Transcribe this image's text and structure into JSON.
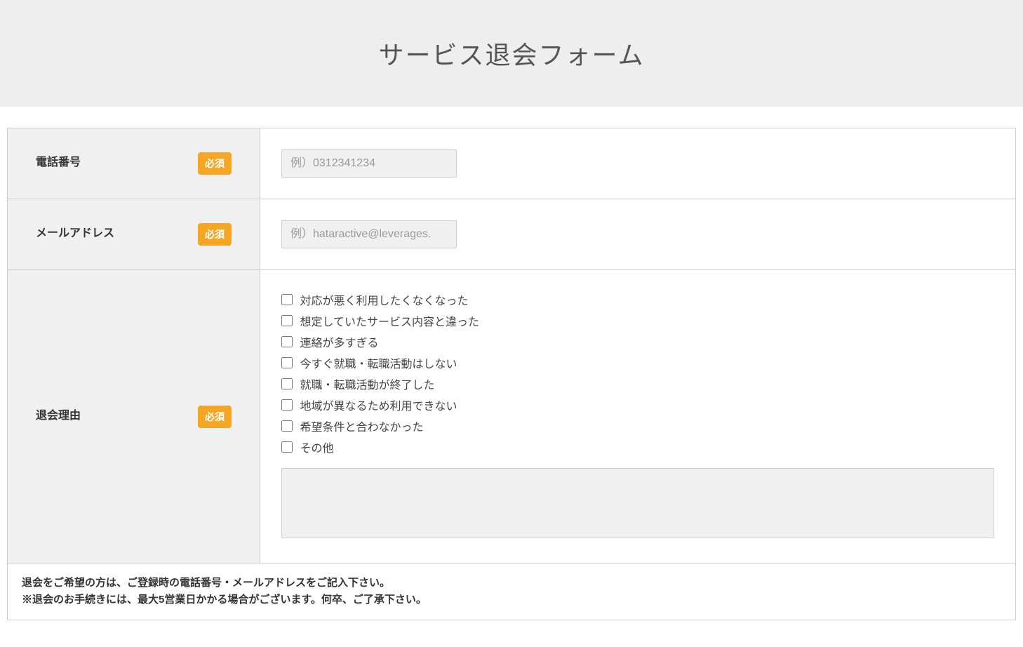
{
  "header": {
    "title": "サービス退会フォーム"
  },
  "labels": {
    "required": "必須"
  },
  "fields": {
    "phone": {
      "label": "電話番号",
      "placeholder": "例）0312341234"
    },
    "email": {
      "label": "メールアドレス",
      "placeholder": "例）hataractive@leverages."
    },
    "reason": {
      "label": "退会理由",
      "options": [
        "対応が悪く利用したくなくなった",
        "想定していたサービス内容と違った",
        "連絡が多すぎる",
        "今すぐ就職・転職活動はしない",
        "就職・転職活動が終了した",
        "地域が異なるため利用できない",
        "希望条件と合わなかった",
        "その他"
      ]
    }
  },
  "footer": {
    "line1": "退会をご希望の方は、ご登録時の電話番号・メールアドレスをご記入下さい。",
    "line2": "※退会のお手続きには、最大5営業日かかる場合がございます。何卒、ご了承下さい。"
  }
}
